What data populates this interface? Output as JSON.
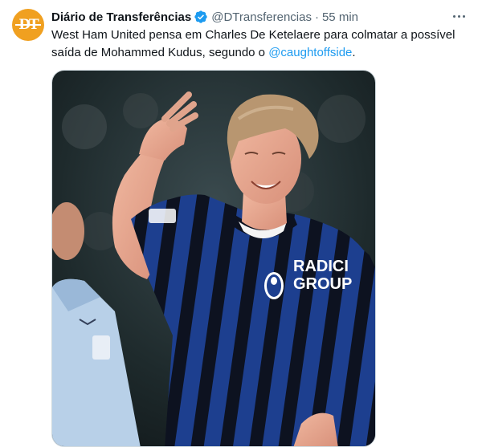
{
  "tweet": {
    "author_name": "Diário de Transferências",
    "handle": "@DTransferencias",
    "separator": "·",
    "time": "55 min",
    "avatar_text": "DT",
    "text_part1": "West Ham United pensa em Charles De Ketelaere para colmatar a possível saída de Mohammed Kudus, segundo o ",
    "mention": "@caughtoffside",
    "text_part2": ".",
    "verified_icon": "verified-badge-icon",
    "more_icon": "more-horizontal-icon"
  },
  "photo": {
    "shirt_sponsor_line1": "RADICI",
    "shirt_sponsor_line2": "GROUP"
  },
  "colors": {
    "accent": "#1d9bf0",
    "text_secondary": "#536471",
    "avatar_bg": "#f0a020",
    "kit_blue": "#1d3f8f",
    "kit_black": "#0d1220"
  }
}
